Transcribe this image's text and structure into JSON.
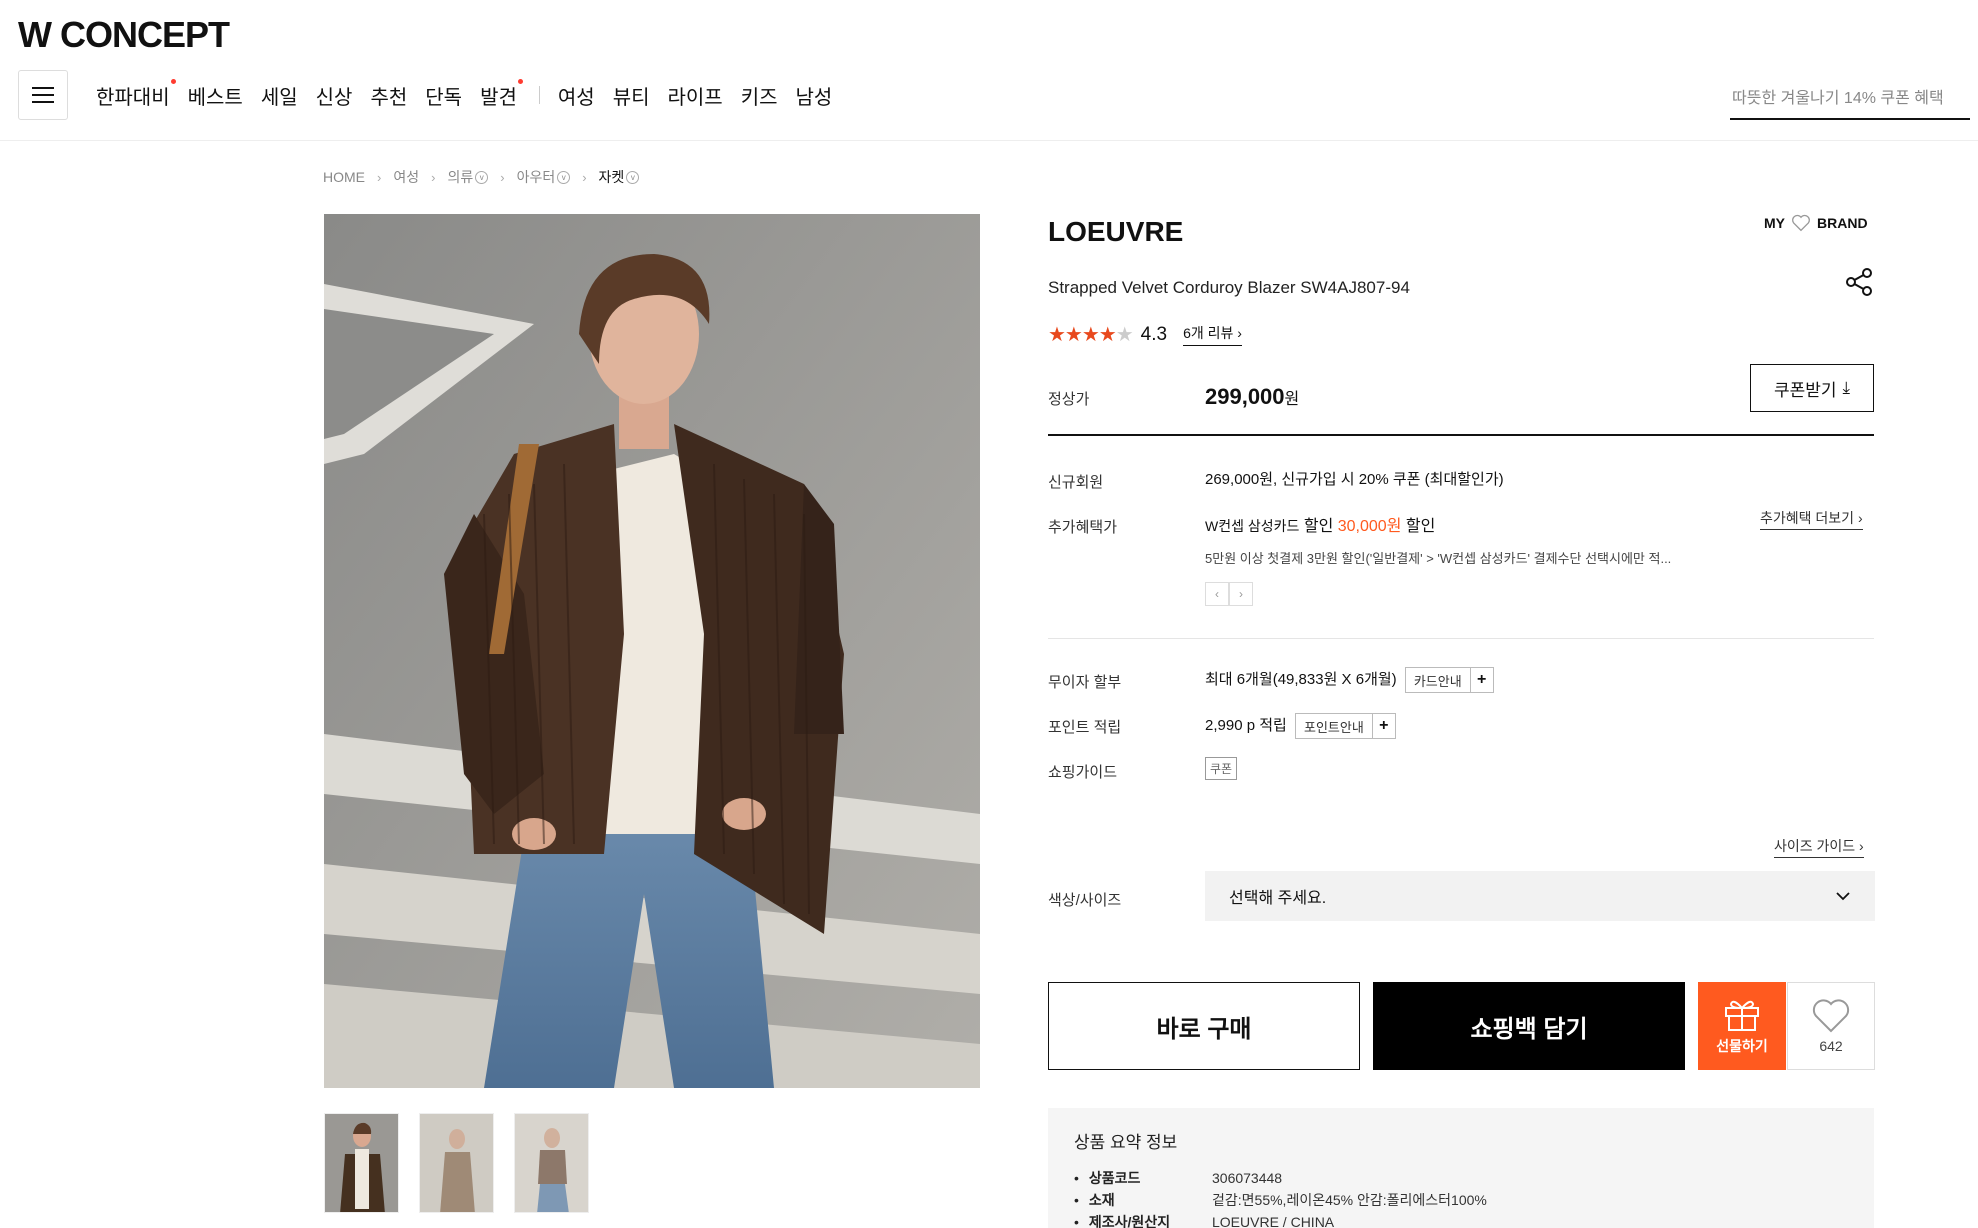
{
  "header": {
    "logo": "W CONCEPT",
    "nav": [
      "한파대비",
      "베스트",
      "세일",
      "신상",
      "추천",
      "단독",
      "발견"
    ],
    "nav_dots": [
      true,
      false,
      false,
      false,
      false,
      false,
      true
    ],
    "nav2": [
      "여성",
      "뷰티",
      "라이프",
      "키즈",
      "남성"
    ],
    "search_text": "따뜻한 겨울나기 14% 쿠폰 혜택"
  },
  "breadcrumb": [
    "HOME",
    "여성",
    "의류",
    "아우터",
    "자켓"
  ],
  "product": {
    "brand": "LOEUVRE",
    "my_label": "MY",
    "brand_label": "BRAND",
    "name": "Strapped Velvet Corduroy Blazer SW4AJ807-94",
    "rating": "4.3",
    "rating_value": 4.3,
    "review_link": "6개 리뷰",
    "price_label": "정상가",
    "price": "299,000",
    "price_unit": "원",
    "coupon_button": "쿠폰받기",
    "new_member_label": "신규회원",
    "new_member_text": "269,000원, 신규가입 시 20% 쿠폰 (최대할인가)",
    "extra_label": "추가혜택가",
    "extra_card": "W컨셉 삼성카드",
    "extra_discount_prefix": "할인",
    "extra_discount_amount": "30,000원",
    "extra_discount_suffix": "할인",
    "extra_more": "추가혜택 더보기",
    "extra_note": "5만원 이상 첫결제 3만원 할인('일반결제' > 'W컨셉 삼성카드' 결제수단 선택시에만 적...",
    "installment_label": "무이자 할부",
    "installment_text": "최대 6개월(49,833원 X 6개월)",
    "card_guide": "카드안내",
    "point_label": "포인트 적립",
    "point_text": "2,990 p 적립",
    "point_guide": "포인트안내",
    "guide_label": "쇼핑가이드",
    "guide_tag": "쿠폰",
    "size_guide": "사이즈 가이드",
    "option_label": "색상/사이즈",
    "option_placeholder": "선택해 주세요.",
    "buy_now": "바로 구매",
    "add_bag": "쇼핑백 담기",
    "gift": "선물하기",
    "like_count": "642"
  },
  "summary": {
    "title": "상품 요약 정보",
    "rows": [
      {
        "k": "상품코드",
        "v": "306073448"
      },
      {
        "k": "소재",
        "v": "겉감:면55%,레이온45% 안감:폴리에스터100%"
      },
      {
        "k": "제조사/원산지",
        "v": "LOEUVRE / CHINA"
      }
    ]
  },
  "colors": {
    "accent": "#ff5a1f",
    "star": "#e8491d",
    "dark": "#000000"
  }
}
